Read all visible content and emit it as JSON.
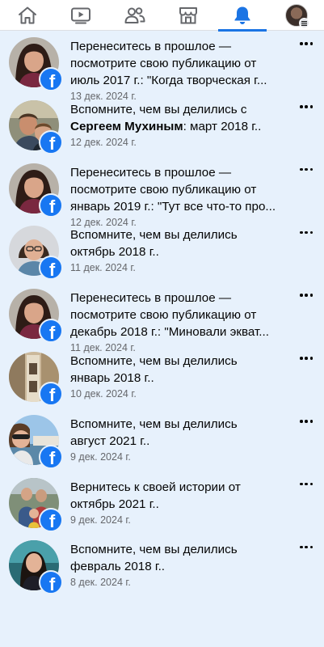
{
  "nav": {
    "tabs": [
      {
        "name": "home",
        "icon": "home-icon",
        "active": false
      },
      {
        "name": "video",
        "icon": "video-icon",
        "active": false
      },
      {
        "name": "friends",
        "icon": "friends-icon",
        "active": false
      },
      {
        "name": "marketplace",
        "icon": "marketplace-icon",
        "active": false
      },
      {
        "name": "notifications",
        "icon": "bell-icon",
        "active": true
      },
      {
        "name": "profile",
        "icon": "profile-avatar",
        "active": false
      }
    ],
    "accent_color": "#1b74e4"
  },
  "notifications": [
    {
      "id": 1,
      "line1": "Перенеситесь в прошлое —",
      "line2": "посмотрите свою публикацию от",
      "line3": "июль 2017 г.: \"Когда творческая г...",
      "time": "13 дек. 2024 г."
    },
    {
      "id": 2,
      "line1": "Вспомните, чем вы делились с",
      "line2_bold": "Сергеем Мухиным",
      "line2_rest": ": март 2018 г..",
      "time": "12 дек. 2024 г."
    },
    {
      "id": 3,
      "line1": "Перенеситесь в прошлое —",
      "line2": "посмотрите свою публикацию от",
      "line3": "январь 2019 г.: \"Тут все что-то про...",
      "time": "12 дек. 2024 г."
    },
    {
      "id": 4,
      "line1": "Вспомните, чем вы делились",
      "line2": "октябрь 2018 г..",
      "time": "11 дек. 2024 г."
    },
    {
      "id": 5,
      "line1": "Перенеситесь в прошлое —",
      "line2": "посмотрите свою публикацию от",
      "line3": "декабрь 2018 г.: \"Миновали экват...",
      "time": "11 дек. 2024 г."
    },
    {
      "id": 6,
      "line1": "Вспомните, чем вы делились",
      "line2": "январь 2018 г..",
      "time": "10 дек. 2024 г."
    },
    {
      "id": 7,
      "line1": "Вспомните, чем вы делились",
      "line2": "август 2021 г..",
      "time": "9 дек. 2024 г."
    },
    {
      "id": 8,
      "line1": "Вернитесь к своей истории от",
      "line2": "октябрь 2021 г..",
      "time": "9 дек. 2024 г."
    },
    {
      "id": 9,
      "line1": "Вспомните, чем вы делились",
      "line2": "февраль 2018 г..",
      "time": "8 дек. 2024 г."
    }
  ],
  "badge": {
    "letter": "f",
    "color": "#1877f2"
  },
  "colors": {
    "background": "#e7f1fc",
    "timestamp": "#65676b"
  }
}
